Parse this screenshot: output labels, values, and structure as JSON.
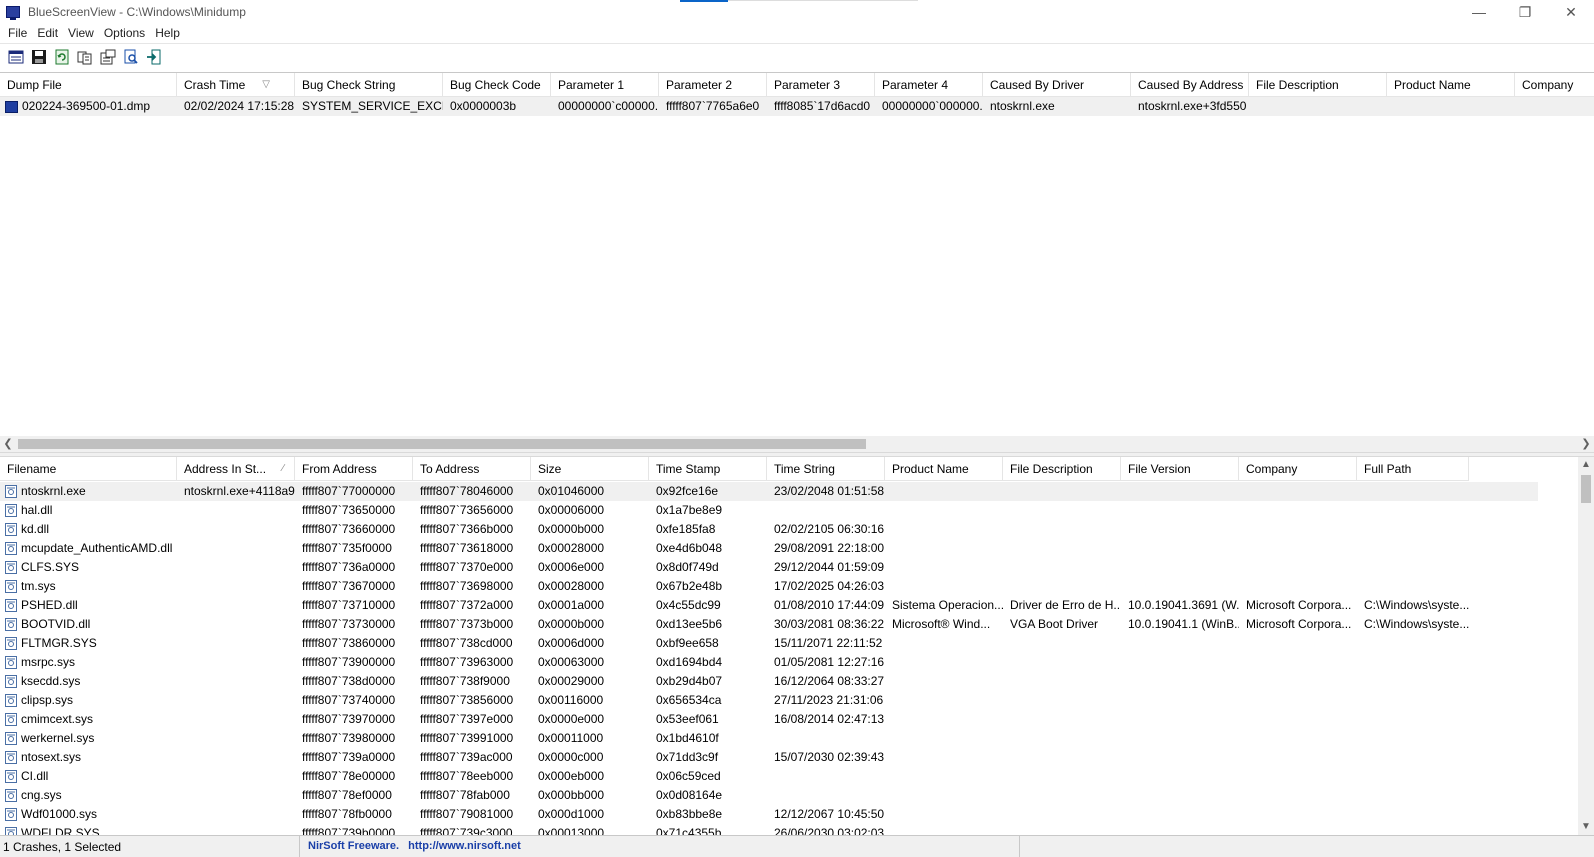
{
  "window": {
    "title": "BlueScreenView  -  C:\\Windows\\Minidump",
    "minimize": "—",
    "restore": "❐",
    "close": "✕"
  },
  "menu": [
    "File",
    "Edit",
    "View",
    "Options",
    "Help"
  ],
  "toolbar": [
    "properties-icon",
    "save-icon",
    "refresh-icon",
    "copy-icon",
    "advanced-options-icon",
    "find-icon",
    "exit-icon"
  ],
  "crash_list": {
    "columns": [
      "Dump File",
      "Crash Time",
      "Bug Check String",
      "Bug Check Code",
      "Parameter 1",
      "Parameter 2",
      "Parameter 3",
      "Parameter 4",
      "Caused By Driver",
      "Caused By Address",
      "File Description",
      "Product Name",
      "Company"
    ],
    "sort_indicator": "▽",
    "rows": [
      [
        "020224-369500-01.dmp",
        "02/02/2024 17:15:28",
        "SYSTEM_SERVICE_EXCEP...",
        "0x0000003b",
        "00000000`c00000...",
        "fffff807`7765a6e0",
        "ffff8085`17d6acd0",
        "00000000`000000...",
        "ntoskrnl.exe",
        "ntoskrnl.exe+3fd550",
        "",
        "",
        ""
      ]
    ]
  },
  "driver_list": {
    "columns": [
      "Filename",
      "Address In St...",
      "From Address",
      "To Address",
      "Size",
      "Time Stamp",
      "Time String",
      "Product Name",
      "File Description",
      "File Version",
      "Company",
      "Full Path"
    ],
    "sort_indicator": "∕",
    "rows": [
      [
        "ntoskrnl.exe",
        "ntoskrnl.exe+4118a9",
        "fffff807`77000000",
        "fffff807`78046000",
        "0x01046000",
        "0x92fce16e",
        "23/02/2048 01:51:58",
        "",
        "",
        "",
        "",
        ""
      ],
      [
        "hal.dll",
        "",
        "fffff807`73650000",
        "fffff807`73656000",
        "0x00006000",
        "0x1a7be8e9",
        "",
        "",
        "",
        "",
        "",
        ""
      ],
      [
        "kd.dll",
        "",
        "fffff807`73660000",
        "fffff807`7366b000",
        "0x0000b000",
        "0xfe185fa8",
        "02/02/2105 06:30:16",
        "",
        "",
        "",
        "",
        ""
      ],
      [
        "mcupdate_AuthenticAMD.dll",
        "",
        "fffff807`735f0000",
        "fffff807`73618000",
        "0x00028000",
        "0xe4d6b048",
        "29/08/2091 22:18:00",
        "",
        "",
        "",
        "",
        ""
      ],
      [
        "CLFS.SYS",
        "",
        "fffff807`736a0000",
        "fffff807`7370e000",
        "0x0006e000",
        "0x8d0f749d",
        "29/12/2044 01:59:09",
        "",
        "",
        "",
        "",
        ""
      ],
      [
        "tm.sys",
        "",
        "fffff807`73670000",
        "fffff807`73698000",
        "0x00028000",
        "0x67b2e48b",
        "17/02/2025 04:26:03",
        "",
        "",
        "",
        "",
        ""
      ],
      [
        "PSHED.dll",
        "",
        "fffff807`73710000",
        "fffff807`7372a000",
        "0x0001a000",
        "0x4c55dc99",
        "01/08/2010 17:44:09",
        "Sistema Operacion...",
        "Driver de Erro de H...",
        "10.0.19041.3691 (W...",
        "Microsoft Corpora...",
        "C:\\Windows\\syste..."
      ],
      [
        "BOOTVID.dll",
        "",
        "fffff807`73730000",
        "fffff807`7373b000",
        "0x0000b000",
        "0xd13ee5b6",
        "30/03/2081 08:36:22",
        "Microsoft® Wind...",
        "VGA Boot Driver",
        "10.0.19041.1 (WinB...",
        "Microsoft Corpora...",
        "C:\\Windows\\syste..."
      ],
      [
        "FLTMGR.SYS",
        "",
        "fffff807`73860000",
        "fffff807`738cd000",
        "0x0006d000",
        "0xbf9ee658",
        "15/11/2071 22:11:52",
        "",
        "",
        "",
        "",
        ""
      ],
      [
        "msrpc.sys",
        "",
        "fffff807`73900000",
        "fffff807`73963000",
        "0x00063000",
        "0xd1694bd4",
        "01/05/2081 12:27:16",
        "",
        "",
        "",
        "",
        ""
      ],
      [
        "ksecdd.sys",
        "",
        "fffff807`738d0000",
        "fffff807`738f9000",
        "0x00029000",
        "0xb29d4b07",
        "16/12/2064 08:33:27",
        "",
        "",
        "",
        "",
        ""
      ],
      [
        "clipsp.sys",
        "",
        "fffff807`73740000",
        "fffff807`73856000",
        "0x00116000",
        "0x656534ca",
        "27/11/2023 21:31:06",
        "",
        "",
        "",
        "",
        ""
      ],
      [
        "cmimcext.sys",
        "",
        "fffff807`73970000",
        "fffff807`7397e000",
        "0x0000e000",
        "0x53eef061",
        "16/08/2014 02:47:13",
        "",
        "",
        "",
        "",
        ""
      ],
      [
        "werkernel.sys",
        "",
        "fffff807`73980000",
        "fffff807`73991000",
        "0x00011000",
        "0x1bd4610f",
        "",
        "",
        "",
        "",
        "",
        ""
      ],
      [
        "ntosext.sys",
        "",
        "fffff807`739a0000",
        "fffff807`739ac000",
        "0x0000c000",
        "0x71dd3c9f",
        "15/07/2030 02:39:43",
        "",
        "",
        "",
        "",
        ""
      ],
      [
        "CI.dll",
        "",
        "fffff807`78e00000",
        "fffff807`78eeb000",
        "0x000eb000",
        "0x06c59ced",
        "",
        "",
        "",
        "",
        "",
        ""
      ],
      [
        "cng.sys",
        "",
        "fffff807`78ef0000",
        "fffff807`78fab000",
        "0x000bb000",
        "0x0d08164e",
        "",
        "",
        "",
        "",
        "",
        ""
      ],
      [
        "Wdf01000.sys",
        "",
        "fffff807`78fb0000",
        "fffff807`79081000",
        "0x000d1000",
        "0xb83bbe8e",
        "12/12/2067 10:45:50",
        "",
        "",
        "",
        "",
        ""
      ],
      [
        "WDFLDR.SYS",
        "",
        "fffff807`739b0000",
        "fffff807`739c3000",
        "0x00013000",
        "0x71c4355b",
        "26/06/2030 03:02:03",
        "",
        "",
        "",
        "",
        ""
      ]
    ]
  },
  "status": {
    "count": "1 Crashes, 1 Selected",
    "vendor": "NirSoft Freeware.",
    "url": "http://www.nirsoft.net"
  }
}
